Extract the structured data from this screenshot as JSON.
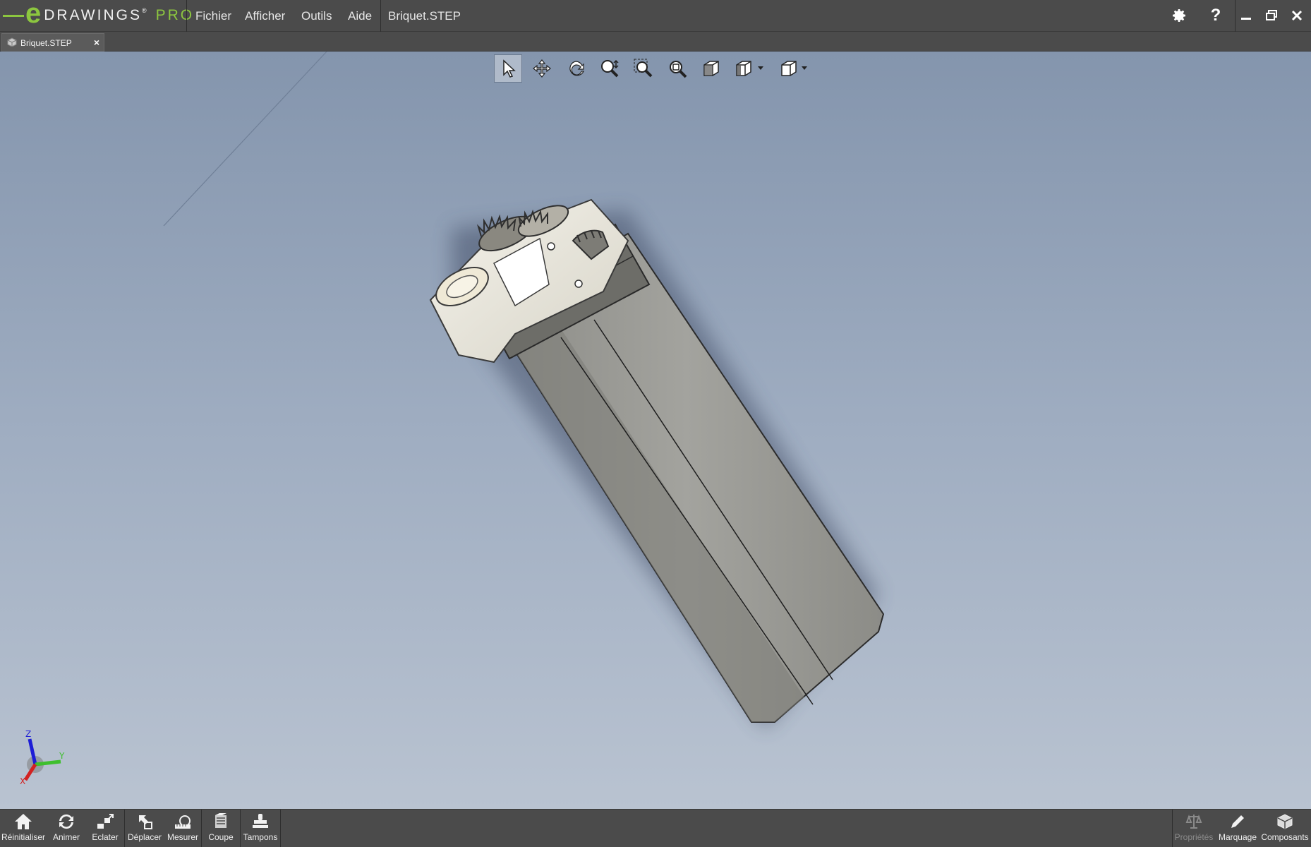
{
  "app": {
    "brand": "DRAWINGS",
    "brand_e": "e",
    "brand_reg": "®",
    "brand_pro": "PRO"
  },
  "menu": {
    "file": "Fichier",
    "view": "Afficher",
    "tools": "Outils",
    "help": "Aide",
    "document": "Briquet.STEP"
  },
  "tab": {
    "label": "Briquet.STEP",
    "close": "×"
  },
  "viewport": {
    "background_top": "#8495ad",
    "background_bottom": "#b9c3d1"
  },
  "view_toolbar": [
    "select-icon",
    "pan-icon",
    "rotate-icon",
    "zoom-icon",
    "zoom-to-area-icon",
    "zoom-to-fit-icon",
    "shaded-view-icon",
    "display-style-icon",
    "view-orientation-icon"
  ],
  "triad": {
    "z": "Z",
    "y": "Y",
    "x": "X"
  },
  "bottom_tools": {
    "reset": "Réinitialiser",
    "animate": "Animer",
    "explode": "Eclater",
    "move": "Déplacer",
    "measure": "Mesurer",
    "section": "Coupe",
    "stamps": "Tampons",
    "properties": "Propriétés",
    "markup": "Marquage",
    "components": "Composants"
  },
  "colors": {
    "accent": "#8cc63f",
    "chrome": "#4b4b4b",
    "model_body": "#8e8e88",
    "model_head": "#e8e6e0"
  }
}
